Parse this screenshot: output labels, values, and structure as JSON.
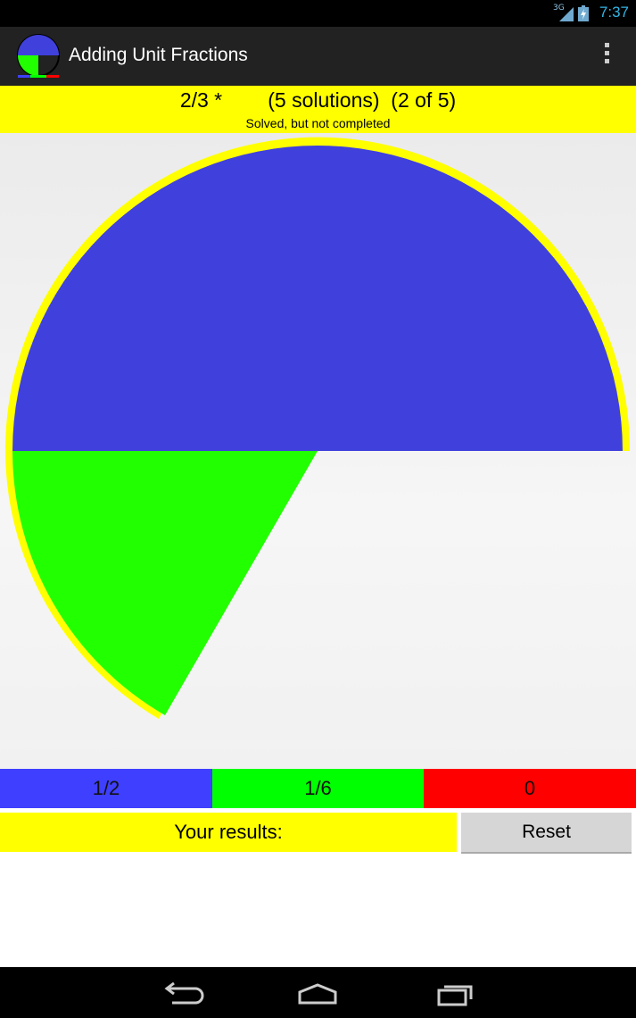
{
  "status_bar": {
    "network": "3G",
    "time": "7:37"
  },
  "action_bar": {
    "title": "Adding Unit Fractions",
    "overflow_icon": "more-vert-icon"
  },
  "info": {
    "headline": "2/3 *        (5 solutions)  (2 of 5)",
    "subtext": "Solved, but not completed"
  },
  "circle": {
    "slices": [
      {
        "fraction": "1/2",
        "color": "#4040dd"
      },
      {
        "fraction": "1/6",
        "color": "#22ff00"
      }
    ],
    "outline_color": "#ffff00"
  },
  "fractions": [
    {
      "label": "1/2",
      "color": "#3f3fff"
    },
    {
      "label": "1/6",
      "color": "#00ff00"
    },
    {
      "label": "0",
      "color": "#ff0000"
    }
  ],
  "results": {
    "label": "Your results:"
  },
  "reset": {
    "label": "Reset"
  },
  "nav": {
    "back": "back-icon",
    "home": "home-icon",
    "recents": "recent-apps-icon"
  }
}
